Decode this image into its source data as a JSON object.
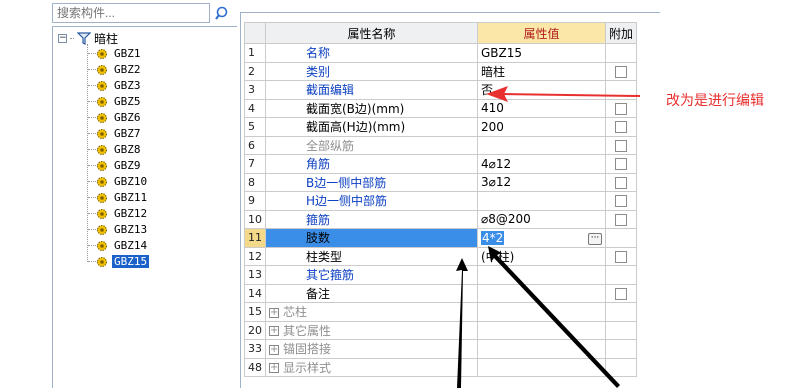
{
  "search": {
    "placeholder": "搜索构件..."
  },
  "tree": {
    "root_label": "暗柱",
    "items": [
      "GBZ1",
      "GBZ2",
      "GBZ3",
      "GBZ5",
      "GBZ6",
      "GBZ7",
      "GBZ8",
      "GBZ9",
      "GBZ10",
      "GBZ11",
      "GBZ12",
      "GBZ13",
      "GBZ14",
      "GBZ15"
    ],
    "selected": "GBZ15"
  },
  "grid": {
    "headers": {
      "name": "属性名称",
      "value": "属性值",
      "extra": "附加"
    },
    "rows": [
      {
        "num": "1",
        "name": "名称",
        "value": "GBZ15",
        "style": "blue",
        "checkbox": false
      },
      {
        "num": "2",
        "name": "类别",
        "value": "暗柱",
        "style": "blue",
        "checkbox": true
      },
      {
        "num": "3",
        "name": "截面编辑",
        "value": "否",
        "style": "blue",
        "checkbox": false
      },
      {
        "num": "4",
        "name": "截面宽(B边)(mm)",
        "value": "410",
        "style": "black",
        "checkbox": true
      },
      {
        "num": "5",
        "name": "截面高(H边)(mm)",
        "value": "200",
        "style": "black",
        "checkbox": true
      },
      {
        "num": "6",
        "name": "全部纵筋",
        "value": "",
        "style": "gray",
        "checkbox": true
      },
      {
        "num": "7",
        "name": "角筋",
        "value": "4⌀12",
        "style": "blue",
        "checkbox": true
      },
      {
        "num": "8",
        "name": "B边一侧中部筋",
        "value": "3⌀12",
        "style": "blue",
        "checkbox": true
      },
      {
        "num": "9",
        "name": "H边一侧中部筋",
        "value": "",
        "style": "blue",
        "checkbox": true
      },
      {
        "num": "10",
        "name": "箍筋",
        "value": "⌀8@200",
        "style": "blue",
        "checkbox": true
      },
      {
        "num": "11",
        "name": "肢数",
        "value": "4*2",
        "style": "black",
        "checkbox": false
      },
      {
        "num": "12",
        "name": "柱类型",
        "value": "(中柱)",
        "style": "black",
        "checkbox": true
      },
      {
        "num": "13",
        "name": "其它箍筋",
        "value": "",
        "style": "blue",
        "checkbox": false
      },
      {
        "num": "14",
        "name": "备注",
        "value": "",
        "style": "black",
        "checkbox": true
      },
      {
        "num": "15",
        "name": "芯柱",
        "value": "",
        "style": "gray",
        "checkbox": false
      },
      {
        "num": "20",
        "name": "其它属性",
        "value": "",
        "style": "gray",
        "checkbox": false
      },
      {
        "num": "33",
        "name": "锚固搭接",
        "value": "",
        "style": "gray",
        "checkbox": false
      },
      {
        "num": "48",
        "name": "显示样式",
        "value": "",
        "style": "gray",
        "checkbox": false
      }
    ],
    "selected_row": "11"
  },
  "annotation": {
    "text": "改为是进行编辑",
    "color": "#e8302f"
  },
  "colors": {
    "selection": "#3b8ee8",
    "tree_selection": "#1c61c9",
    "header_value_bg": "#fbe7a8"
  }
}
